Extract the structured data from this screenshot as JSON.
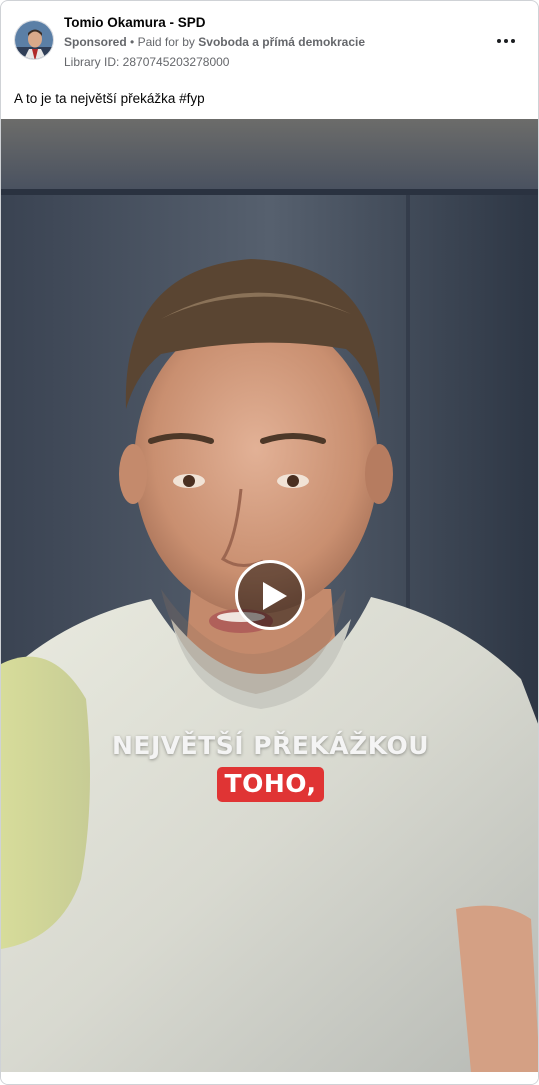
{
  "post": {
    "page_name": "Tomio Okamura - SPD",
    "sponsored": "Sponsored",
    "paid_for_prefix": "Paid for by",
    "payer": "Svoboda a přímá demokracie",
    "library_id": "Library ID: 2870745203278000",
    "caption": "A to je ta největší překážka #fyp",
    "more_icon": "more-horizontal-icon"
  },
  "video": {
    "subtitle_line1": "NEJVĚTŠÍ PŘEKÁŽKOU",
    "subtitle_line2": "TOHO,",
    "play_icon": "play-icon",
    "highlight_color": "#e03434"
  }
}
